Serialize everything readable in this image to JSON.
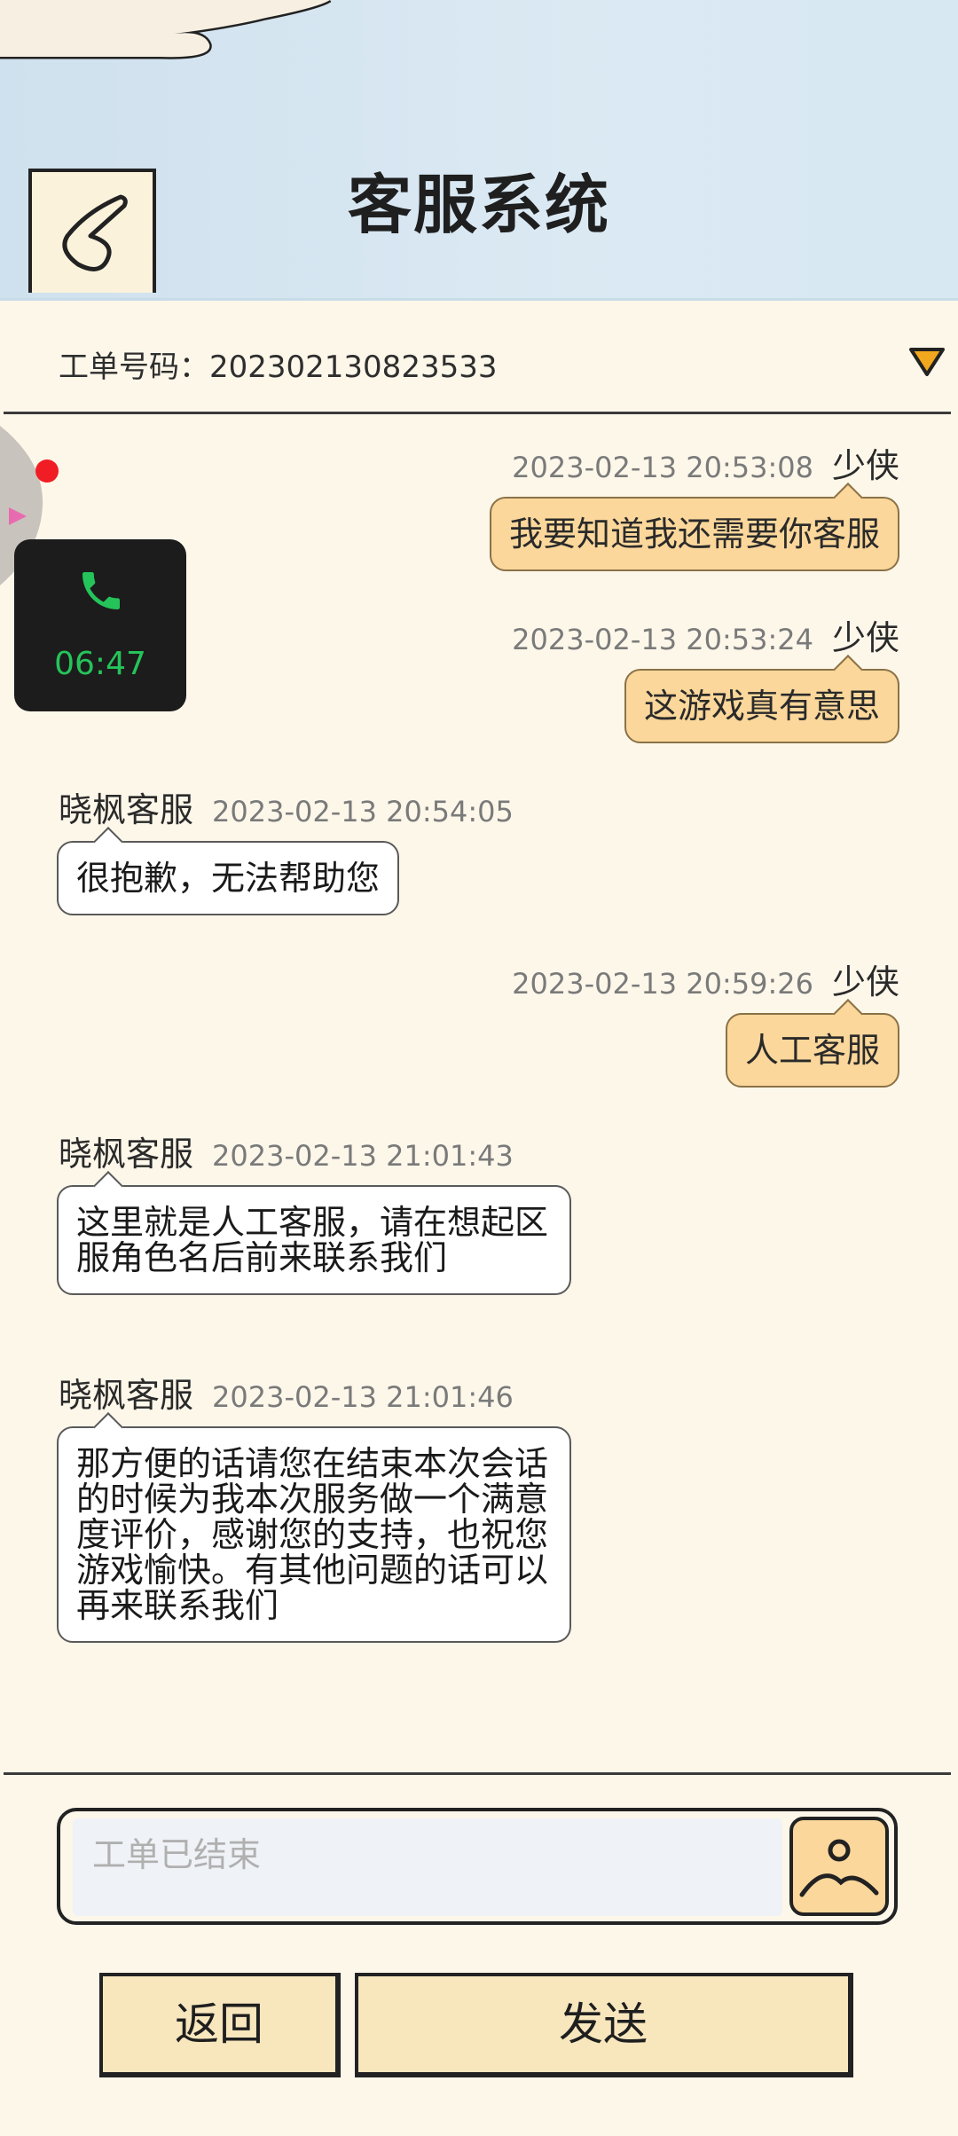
{
  "header": {
    "title": "客服系统"
  },
  "ticket": {
    "label": "工单号码：",
    "number": "202302130823533"
  },
  "call_widget": {
    "timer": "06:47"
  },
  "messages": [
    {
      "sender": "少侠",
      "time": "2023-02-13 20:53:08",
      "text": "我要知道我还需要你客服"
    },
    {
      "sender": "少侠",
      "time": "2023-02-13 20:53:24",
      "text": "这游戏真有意思"
    },
    {
      "sender": "晓枫客服",
      "time": "2023-02-13 20:54:05",
      "text": "很抱歉，无法帮助您"
    },
    {
      "sender": "少侠",
      "time": "2023-02-13 20:59:26",
      "text": "人工客服"
    },
    {
      "sender": "晓枫客服",
      "time": "2023-02-13 21:01:43",
      "text": "这里就是人工客服，请在想起区服角色名后前来联系我们"
    },
    {
      "sender": "晓枫客服",
      "time": "2023-02-13 21:01:46",
      "text": "那方便的话请您在结束本次会话的时候为我本次服务做一个满意度评价，感谢您的支持，也祝您游戏愉快。有其他问题的话可以再来联系我们"
    }
  ],
  "input": {
    "placeholder": "工单已结束"
  },
  "buttons": {
    "back": "返回",
    "send": "发送"
  },
  "colors": {
    "user_bubble": "#fbd79b",
    "agent_bubble": "#ffffff",
    "header_bg": "#d4e6f1",
    "page_bg": "#fdf7ea",
    "timer_green": "#25c45a"
  }
}
